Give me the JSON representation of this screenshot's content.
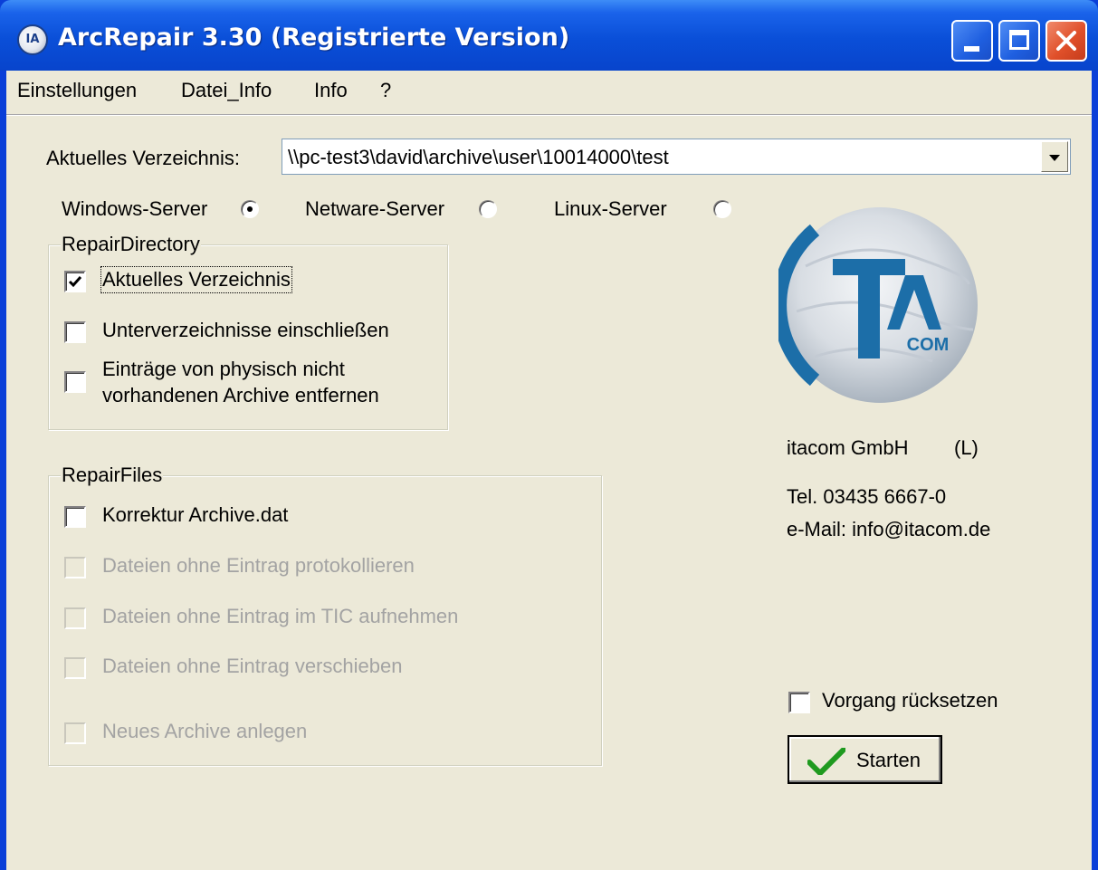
{
  "window": {
    "title": "ArcRepair 3.30 (Registrierte Version)",
    "icon_label": "IA"
  },
  "menu": [
    "Einstellungen",
    "Datei_Info",
    "Info",
    "?"
  ],
  "directory": {
    "label": "Aktuelles Verzeichnis:",
    "value": "\\\\pc-test3\\david\\archive\\user\\10014000\\test"
  },
  "servers": [
    {
      "label": "Windows-Server",
      "selected": true
    },
    {
      "label": "Netware-Server",
      "selected": false
    },
    {
      "label": "Linux-Server",
      "selected": false
    }
  ],
  "repair_directory": {
    "title": "RepairDirectory",
    "options": [
      {
        "label": "Aktuelles Verzeichnis",
        "checked": true
      },
      {
        "label": "Unterverzeichnisse einschließen",
        "checked": false
      },
      {
        "label_line1": "Einträge von physisch nicht",
        "label_line2": "vorhandenen Archive entfernen",
        "checked": false
      }
    ]
  },
  "repair_files": {
    "title": "RepairFiles",
    "options": [
      {
        "label": "Korrektur Archive.dat",
        "checked": false,
        "enabled": true
      },
      {
        "label": "Dateien ohne Eintrag protokollieren",
        "checked": false,
        "enabled": false
      },
      {
        "label": "Dateien ohne Eintrag im TIC aufnehmen",
        "checked": false,
        "enabled": false
      },
      {
        "label": "Dateien ohne Eintrag verschieben",
        "checked": false,
        "enabled": false
      },
      {
        "label": "Neues Archive anlegen",
        "checked": false,
        "enabled": false
      }
    ]
  },
  "company": {
    "logo_text": "iTA",
    "logo_sub": "COM",
    "name": "itacom GmbH",
    "license": "(L)",
    "phone": "Tel. 03435 6667-0",
    "email": "e-Mail: info@itacom.de"
  },
  "reset": {
    "label": "Vorgang rücksetzen",
    "checked": false
  },
  "start_button": {
    "label": "Starten"
  },
  "colors": {
    "titlebar": "#0a4fd8",
    "face": "#ece9d8",
    "check_green": "#1f9a1f",
    "logo_blue": "#1c6ea8"
  }
}
